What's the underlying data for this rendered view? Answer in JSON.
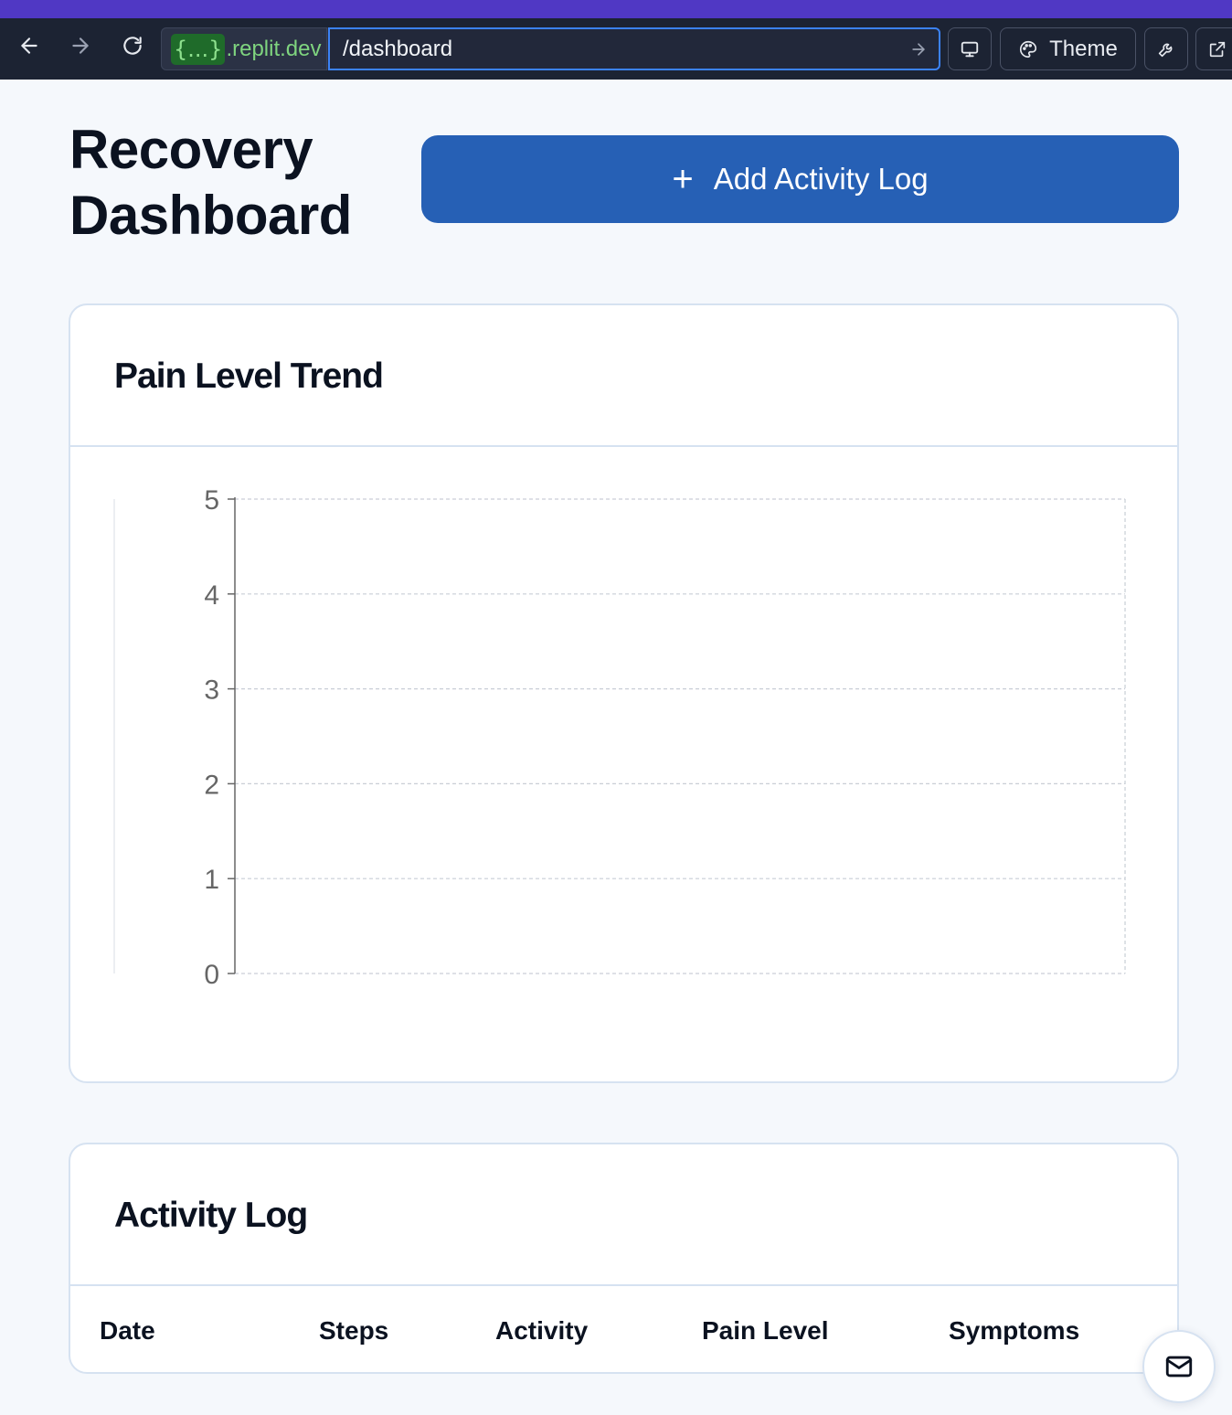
{
  "browser": {
    "domain_chip": "{...}",
    "domain": ".replit.dev",
    "path": "/dashboard",
    "theme_label": "Theme"
  },
  "icons": {
    "back": "arrow-left-icon",
    "forward": "arrow-right-icon",
    "reload": "reload-icon",
    "go": "go-arrow-icon",
    "device": "monitor-icon",
    "theme": "palette-icon",
    "tools": "wrench-icon",
    "external": "external-link-icon",
    "mail": "mail-icon"
  },
  "header": {
    "title_line1": "Recovery",
    "title_line2": "Dashboard",
    "add_button_label": "Add Activity Log"
  },
  "pain_card": {
    "title": "Pain Level Trend"
  },
  "chart_data": {
    "type": "line",
    "title": "Pain Level Trend",
    "xlabel": "",
    "ylabel": "",
    "ylim": [
      0,
      5
    ],
    "yticks": [
      0,
      1,
      2,
      3,
      4,
      5
    ],
    "x": [],
    "series": [],
    "grid": true,
    "grid_style": "dashed"
  },
  "activity_card": {
    "title": "Activity Log",
    "columns": [
      "Date",
      "Steps",
      "Activity",
      "Pain Level",
      "Symptoms"
    ],
    "rows": []
  },
  "colors": {
    "primary": "#2660b5",
    "accent_strip": "#5038c4",
    "browser_bar": "#1c2333",
    "url_focus": "#3b82f6",
    "domain_green": "#7fd47f",
    "card_border": "#d6e2f1",
    "page_bg": "#f5f8fc"
  }
}
